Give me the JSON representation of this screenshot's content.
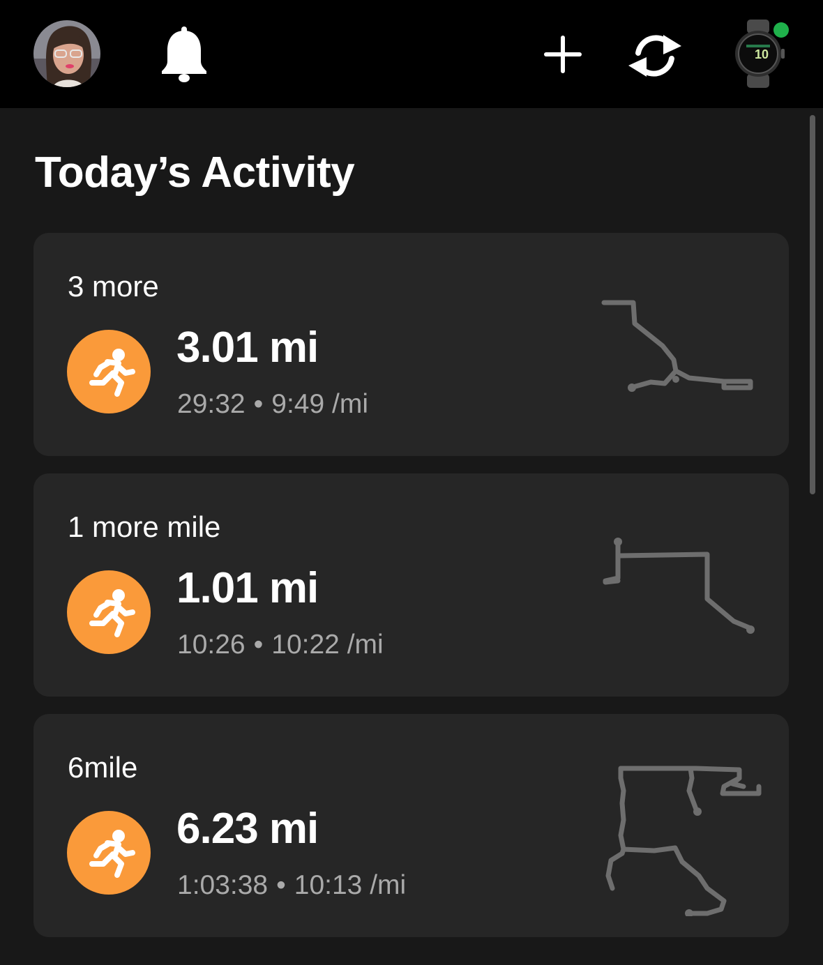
{
  "header": {
    "profile_icon": "avatar",
    "notification_icon": "bell-icon",
    "add_icon": "plus-icon",
    "sync_icon": "sync-icon",
    "device_icon": "watch-icon",
    "device_status_color": "#1fb14b"
  },
  "page": {
    "title": "Today’s Activity"
  },
  "activities": [
    {
      "name": "3 more",
      "distance": "3.01 mi",
      "duration": "29:32",
      "pace": "9:49 /mi",
      "separator": "•",
      "activity_icon": "running-icon"
    },
    {
      "name": "1 more mile",
      "distance": "1.01 mi",
      "duration": "10:26",
      "pace": "10:22 /mi",
      "separator": "•",
      "activity_icon": "running-icon"
    },
    {
      "name": "6mile",
      "distance": "6.23 mi",
      "duration": "1:03:38",
      "pace": "10:13 /mi",
      "separator": "•",
      "activity_icon": "running-icon"
    }
  ],
  "colors": {
    "activity_badge": "#fa9a3a",
    "card_background": "#262626",
    "page_background": "#181818",
    "secondary_text": "#aaaaaa",
    "route_line": "#6e6e6e"
  }
}
